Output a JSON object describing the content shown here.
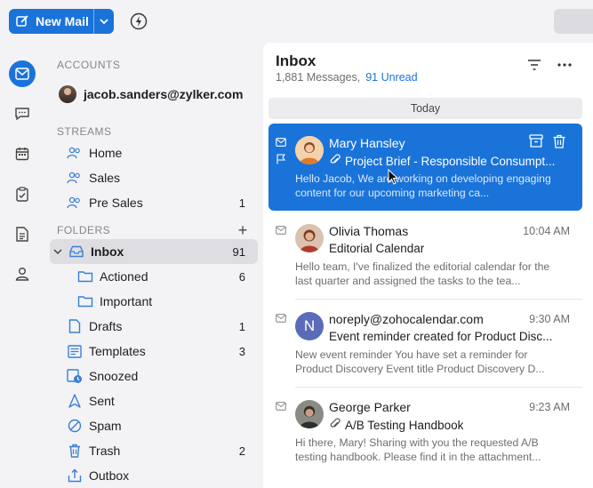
{
  "toolbar": {
    "new_mail_label": "New Mail"
  },
  "accounts": {
    "heading": "ACCOUNTS",
    "email": "jacob.sanders@zylker.com"
  },
  "streams": {
    "heading": "STREAMS",
    "items": [
      {
        "label": "Home",
        "count": ""
      },
      {
        "label": "Sales",
        "count": ""
      },
      {
        "label": "Pre Sales",
        "count": "1"
      }
    ]
  },
  "folders": {
    "heading": "FOLDERS",
    "items": [
      {
        "label": "Inbox",
        "count": "91",
        "icon": "inbox-icon"
      },
      {
        "label": "Actioned",
        "count": "6",
        "icon": "folder-icon"
      },
      {
        "label": "Important",
        "count": "",
        "icon": "folder-icon"
      },
      {
        "label": "Drafts",
        "count": "1",
        "icon": "draft-icon"
      },
      {
        "label": "Templates",
        "count": "3",
        "icon": "template-icon"
      },
      {
        "label": "Snoozed",
        "count": "",
        "icon": "snooze-icon"
      },
      {
        "label": "Sent",
        "count": "",
        "icon": "sent-icon"
      },
      {
        "label": "Spam",
        "count": "",
        "icon": "spam-icon"
      },
      {
        "label": "Trash",
        "count": "2",
        "icon": "trash-icon"
      },
      {
        "label": "Outbox",
        "count": "",
        "icon": "outbox-icon"
      }
    ]
  },
  "inbox": {
    "title": "Inbox",
    "messages_count": "1,881 Messages,",
    "unread_count": "91 Unread",
    "date_group": "Today"
  },
  "mails": [
    {
      "sender": "Mary Hansley",
      "time": "",
      "subject": "Project Brief - Responsible Consumpt...",
      "preview": "Hello Jacob, We are working on developing engaging content for our upcoming marketing ca...",
      "has_attachment": true,
      "avatar_initial": ""
    },
    {
      "sender": "Olivia Thomas",
      "time": "10:04 AM",
      "subject": "Editorial Calendar",
      "preview": "Hello team, I've finalized the editorial calendar for the last quarter and assigned the tasks to the tea...",
      "has_attachment": false,
      "avatar_initial": ""
    },
    {
      "sender": "noreply@zohocalendar.com",
      "time": "9:30 AM",
      "subject": "Event reminder created for Product Disc...",
      "preview": "New event reminder You have set a reminder for Product Discovery Event title Product Discovery D...",
      "has_attachment": false,
      "avatar_initial": "N"
    },
    {
      "sender": "George Parker",
      "time": "9:23 AM",
      "subject": "A/B Testing Handbook",
      "preview": "Hi there, Mary! Sharing with you the requested A/B testing handbook. Please find it in the attachment...",
      "has_attachment": true,
      "avatar_initial": ""
    }
  ],
  "colors": {
    "accent": "#1a73d9",
    "icon_blue": "#3a7fd5"
  }
}
